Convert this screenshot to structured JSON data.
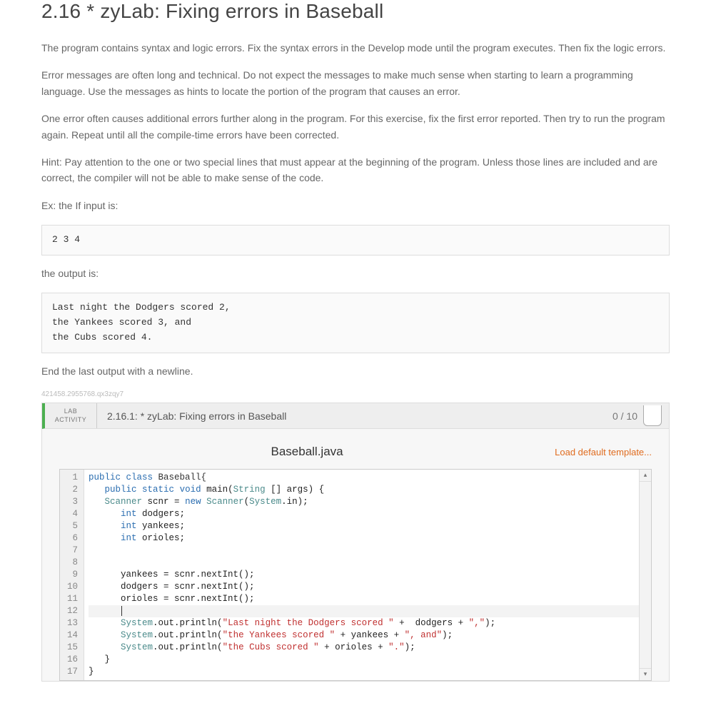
{
  "title": "2.16 * zyLab: Fixing errors in Baseball",
  "paragraphs": [
    "The program contains syntax and logic errors. Fix the syntax errors in the Develop mode until the program executes. Then fix the logic errors.",
    "Error messages are often long and technical. Do not expect the messages to make much sense when starting to learn a programming language. Use the messages as hints to locate the portion of the program that causes an error.",
    "One error often causes additional errors further along in the program. For this exercise, fix the first error reported. Then try to run the program again. Repeat until all the compile-time errors have been corrected.",
    "Hint: Pay attention to the one or two special lines that must appear at the beginning of the program. Unless those lines are included and are correct, the compiler will not be able to make sense of the code.",
    "Ex: the If input is:"
  ],
  "input_example": "2 3 4",
  "output_label": "the output is:",
  "output_example": "Last night the Dodgers scored 2,\nthe Yankees scored 3, and\nthe Cubs scored 4.",
  "end_note": "End the last output with a newline.",
  "small_id": "421458.2955768.qx3zqy7",
  "activity": {
    "type_line1": "LAB",
    "type_line2": "ACTIVITY",
    "title": "2.16.1: * zyLab: Fixing errors in Baseball",
    "score": "0 / 10"
  },
  "editor": {
    "filename": "Baseball.java",
    "load_template": "Load default template...",
    "highlight_line": 12,
    "lines": [
      {
        "n": 1,
        "tokens": [
          {
            "t": "public ",
            "c": "kw"
          },
          {
            "t": "class ",
            "c": "kw"
          },
          {
            "t": "Baseball{",
            "c": "cls"
          }
        ],
        "indent": 0
      },
      {
        "n": 2,
        "tokens": [
          {
            "t": "public ",
            "c": "kw"
          },
          {
            "t": "static ",
            "c": "kw"
          },
          {
            "t": "void ",
            "c": "kw"
          },
          {
            "t": "main",
            "c": ""
          },
          {
            "t": "(",
            "c": ""
          },
          {
            "t": "String ",
            "c": "type"
          },
          {
            "t": "[] args) {",
            "c": ""
          }
        ],
        "indent": 3
      },
      {
        "n": 3,
        "tokens": [
          {
            "t": "Scanner ",
            "c": "type"
          },
          {
            "t": "scnr = ",
            "c": ""
          },
          {
            "t": "new ",
            "c": "kw"
          },
          {
            "t": "Scanner",
            "c": "type"
          },
          {
            "t": "(",
            "c": ""
          },
          {
            "t": "System",
            "c": "type"
          },
          {
            "t": ".in);",
            "c": ""
          }
        ],
        "indent": 3
      },
      {
        "n": 4,
        "tokens": [
          {
            "t": "int ",
            "c": "kw"
          },
          {
            "t": "dodgers;",
            "c": ""
          }
        ],
        "indent": 6
      },
      {
        "n": 5,
        "tokens": [
          {
            "t": "int ",
            "c": "kw"
          },
          {
            "t": "yankees;",
            "c": ""
          }
        ],
        "indent": 6
      },
      {
        "n": 6,
        "tokens": [
          {
            "t": "int ",
            "c": "kw"
          },
          {
            "t": "orioles;",
            "c": ""
          }
        ],
        "indent": 6
      },
      {
        "n": 7,
        "tokens": [],
        "indent": 6
      },
      {
        "n": 8,
        "tokens": [],
        "indent": 6
      },
      {
        "n": 9,
        "tokens": [
          {
            "t": "yankees = scnr.nextInt();",
            "c": ""
          }
        ],
        "indent": 6
      },
      {
        "n": 10,
        "tokens": [
          {
            "t": "dodgers = scnr.nextInt();",
            "c": ""
          }
        ],
        "indent": 6
      },
      {
        "n": 11,
        "tokens": [
          {
            "t": "orioles = scnr.nextInt();",
            "c": ""
          }
        ],
        "indent": 6
      },
      {
        "n": 12,
        "tokens": [],
        "indent": 6,
        "cursor": true
      },
      {
        "n": 13,
        "tokens": [
          {
            "t": "System",
            "c": "type"
          },
          {
            "t": ".out.println(",
            "c": ""
          },
          {
            "t": "\"Last night the Dodgers scored \"",
            "c": "str"
          },
          {
            "t": " +  dodgers + ",
            "c": ""
          },
          {
            "t": "\",\"",
            "c": "str"
          },
          {
            "t": ");",
            "c": ""
          }
        ],
        "indent": 6
      },
      {
        "n": 14,
        "tokens": [
          {
            "t": "System",
            "c": "type"
          },
          {
            "t": ".out.println(",
            "c": ""
          },
          {
            "t": "\"the Yankees scored \"",
            "c": "str"
          },
          {
            "t": " + yankees + ",
            "c": ""
          },
          {
            "t": "\", and\"",
            "c": "str"
          },
          {
            "t": ");",
            "c": ""
          }
        ],
        "indent": 6
      },
      {
        "n": 15,
        "tokens": [
          {
            "t": "System",
            "c": "type"
          },
          {
            "t": ".out.println(",
            "c": ""
          },
          {
            "t": "\"the Cubs scored \"",
            "c": "str"
          },
          {
            "t": " + orioles + ",
            "c": ""
          },
          {
            "t": "\".\"",
            "c": "str"
          },
          {
            "t": ");",
            "c": ""
          }
        ],
        "indent": 6
      },
      {
        "n": 16,
        "tokens": [
          {
            "t": "}",
            "c": ""
          }
        ],
        "indent": 3
      },
      {
        "n": 17,
        "tokens": [
          {
            "t": "}",
            "c": ""
          }
        ],
        "indent": 0
      }
    ]
  }
}
